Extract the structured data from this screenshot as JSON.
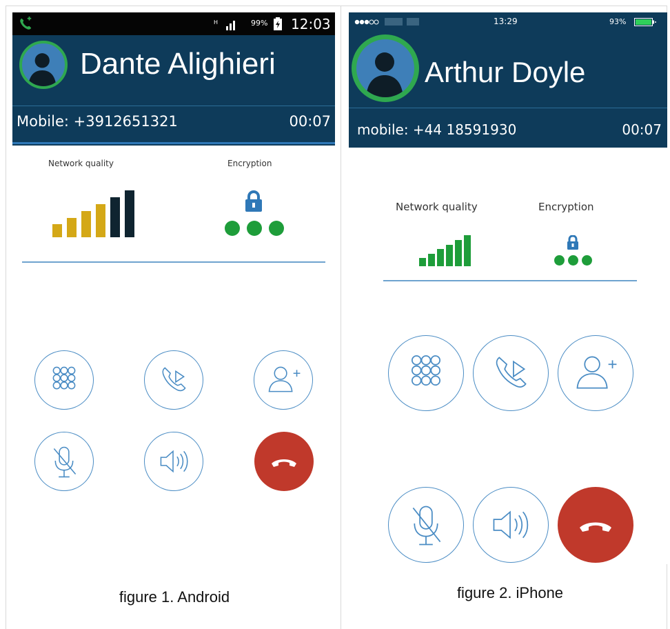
{
  "android": {
    "status": {
      "time": "12:03",
      "battery": "99%"
    },
    "contact_name": "Dante Alighieri",
    "phone_label": "Mobile: +3912651321",
    "call_timer": "00:07",
    "network_label": "Network quality",
    "encryption_label": "Encryption",
    "network_level": 6,
    "network_total": 6,
    "caption": "figure 1. Android",
    "colors": {
      "status_bg": "#050505",
      "header_bg": "#0e3b5a",
      "avatar_ring": "#2fa84f",
      "bar_gold": "#d4a817",
      "bar_dark": "#0f2430",
      "dot_green": "#1e9d3a",
      "lock_blue": "#2f78b7",
      "end_red": "#c0392b"
    }
  },
  "iphone": {
    "status": {
      "carrier": "",
      "time": "13:29",
      "battery": "93%"
    },
    "contact_name": "Arthur Doyle",
    "phone_label": "mobile: +44 18591930",
    "call_timer": "00:07",
    "network_label": "Network quality",
    "encryption_label": "Encryption",
    "network_level": 6,
    "network_total": 6,
    "caption": "figure 2. iPhone",
    "colors": {
      "status_bg": "#0e3b5a",
      "header_bg": "#0e3b5a",
      "avatar_ring": "#2fa84f",
      "bar_green": "#1e9d3a",
      "dot_green": "#1e9d3a",
      "lock_blue": "#2f78b7",
      "end_red": "#c0392b"
    }
  },
  "icons": {
    "keypad": "keypad-icon",
    "call_transfer": "phone-play-icon",
    "add_contact": "add-user-icon",
    "mute": "mic-off-icon",
    "speaker": "speaker-icon",
    "end_call": "end-call-icon"
  }
}
